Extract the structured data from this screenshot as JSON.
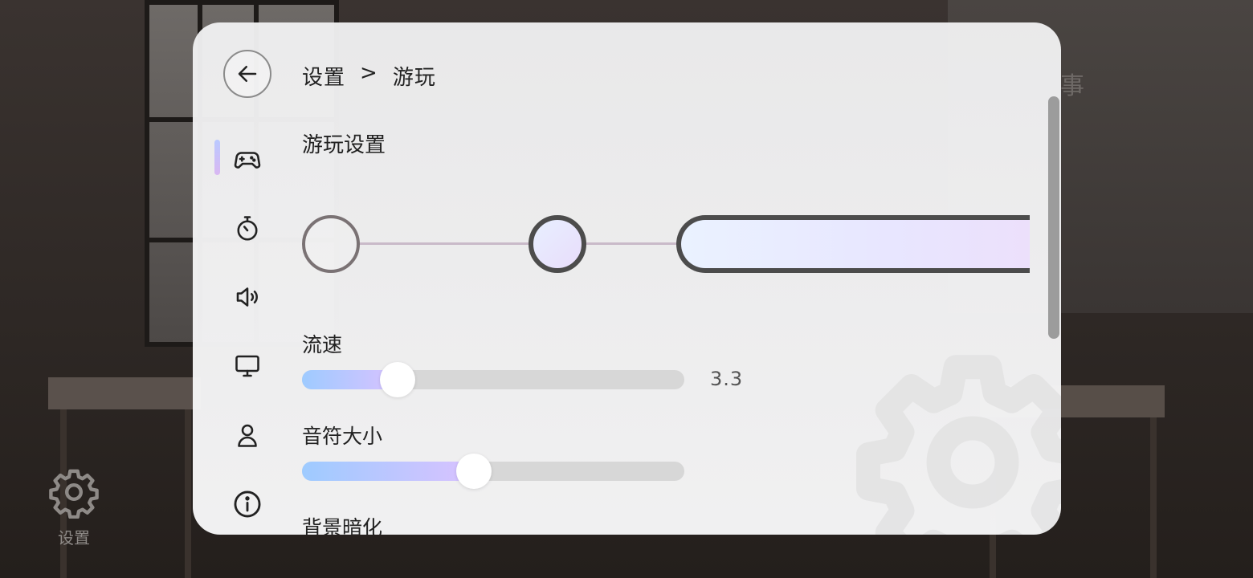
{
  "app": {
    "settings_shortcut_label": "设置"
  },
  "background": {
    "ghost_text": "事"
  },
  "header": {
    "breadcrumb_root": "设置",
    "breadcrumb_sep": ">",
    "breadcrumb_current": "游玩"
  },
  "nav": {
    "items": [
      {
        "icon": "gamepad-icon",
        "active": true
      },
      {
        "icon": "stopwatch-icon",
        "active": false
      },
      {
        "icon": "speaker-icon",
        "active": false
      },
      {
        "icon": "monitor-icon",
        "active": false
      },
      {
        "icon": "user-icon",
        "active": false
      },
      {
        "icon": "info-icon",
        "active": false
      }
    ]
  },
  "section": {
    "title": "游玩设置"
  },
  "stepper": {
    "steps": 3,
    "current_step": 3
  },
  "settings": {
    "flow_speed": {
      "label": "流速",
      "value": "3.3",
      "fraction": 0.25
    },
    "note_size": {
      "label": "音符大小",
      "fraction": 0.45
    },
    "bg_dim": {
      "label": "背景暗化"
    }
  },
  "colors": {
    "accent_start": "#9ecbff",
    "accent_end": "#d9c2ff",
    "panel_bg": "#f2f2f3",
    "text": "#222222"
  }
}
